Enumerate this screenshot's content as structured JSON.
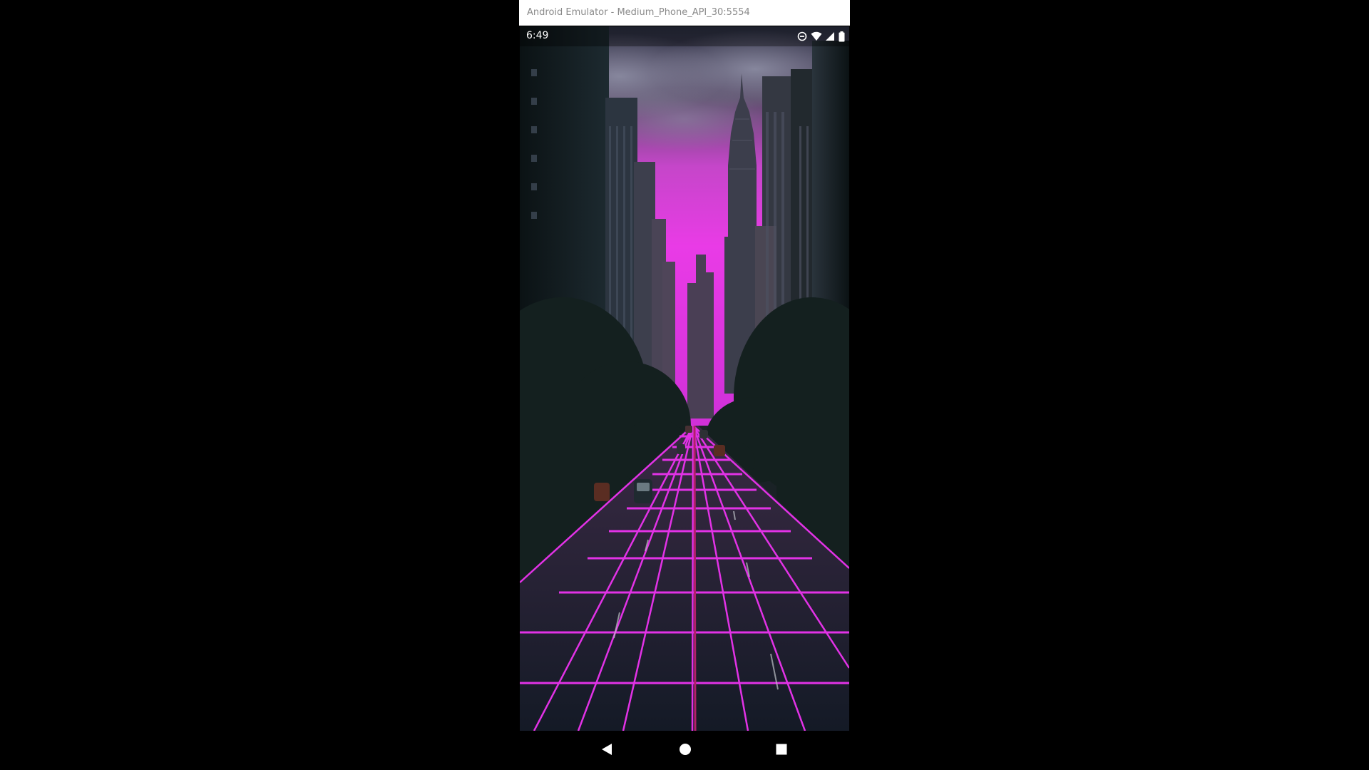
{
  "window": {
    "title": "Android Emulator - Medium_Phone_API_30:5554"
  },
  "status_bar": {
    "time": "6:49",
    "icons": [
      "do-not-disturb-icon",
      "wifi-icon",
      "cell-signal-icon",
      "battery-icon"
    ]
  },
  "wallpaper": {
    "description_colors": {
      "sky_glow": "#e23ce0",
      "grid_lines": "#e232e6",
      "shadow": "#0e1518"
    }
  },
  "nav_bar": {
    "buttons": [
      "back-icon",
      "home-icon",
      "recents-icon"
    ]
  }
}
